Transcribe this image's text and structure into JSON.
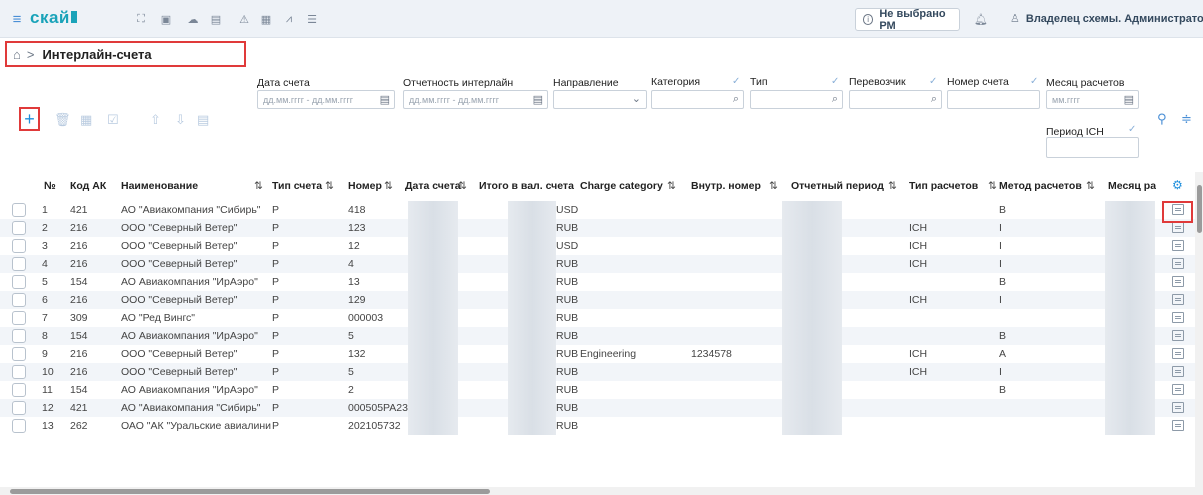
{
  "header": {
    "logo": "скай",
    "pm_button": "Не выбрано РМ",
    "pm_icon": "info-icon",
    "owner": "Владелец схемы. Администратор",
    "nav_icons": [
      "expand-icon",
      "camera-icon",
      "cloud-icon",
      "document-icon",
      "warning-icon",
      "calendar-icon",
      "chart-icon",
      "list-icon"
    ]
  },
  "breadcrumb": {
    "title": "Интерлайн-счета"
  },
  "filters": {
    "date_label": "Дата счета",
    "date_placeholder": "дд.мм.гггг - дд.мм.гггг",
    "report_label": "Отчетность интерлайн",
    "report_placeholder": "дд.мм.гггг - дд.мм.гггг",
    "direction_label": "Направление",
    "category_label": "Категория",
    "type_label": "Тип",
    "carrier_label": "Перевозчик",
    "invoice_label": "Номер счета",
    "month_label": "Месяц расчетов",
    "month_placeholder": "мм.гггг",
    "ich_label": "Период ICH"
  },
  "table": {
    "columns": [
      "№",
      "Код АК",
      "Наименование",
      "Тип счета",
      "Номер",
      "Дата счета",
      "Итого в вал. счета",
      "Charge category",
      "Внутр. номер",
      "Отчетный период",
      "Тип расчетов",
      "Метод расчетов",
      "Месяц рас"
    ],
    "rows": [
      {
        "n": "1",
        "code": "421",
        "name": "АО \"Авиакомпания \"Сибирь\"",
        "type": "P",
        "num": "418",
        "cur": "USD",
        "cat": "",
        "inner": "",
        "settle": "",
        "method": "B"
      },
      {
        "n": "2",
        "code": "216",
        "name": "ООО \"Северный Ветер\"",
        "type": "P",
        "num": "123",
        "cur": "RUB",
        "cat": "",
        "inner": "",
        "settle": "ICH",
        "method": "I"
      },
      {
        "n": "3",
        "code": "216",
        "name": "ООО \"Северный Ветер\"",
        "type": "P",
        "num": "12",
        "cur": "USD",
        "cat": "",
        "inner": "",
        "settle": "ICH",
        "method": "I"
      },
      {
        "n": "4",
        "code": "216",
        "name": "ООО \"Северный Ветер\"",
        "type": "P",
        "num": "4",
        "cur": "RUB",
        "cat": "",
        "inner": "",
        "settle": "ICH",
        "method": "I"
      },
      {
        "n": "5",
        "code": "154",
        "name": "АО Авиакомпания \"ИрАэро\"",
        "type": "P",
        "num": "13",
        "cur": "RUB",
        "cat": "",
        "inner": "",
        "settle": "",
        "method": "B"
      },
      {
        "n": "6",
        "code": "216",
        "name": "ООО \"Северный Ветер\"",
        "type": "P",
        "num": "129",
        "cur": "RUB",
        "cat": "",
        "inner": "",
        "settle": "ICH",
        "method": "I"
      },
      {
        "n": "7",
        "code": "309",
        "name": "АО \"Ред Вингс\"",
        "type": "P",
        "num": "000003",
        "cur": "RUB",
        "cat": "",
        "inner": "",
        "settle": "",
        "method": ""
      },
      {
        "n": "8",
        "code": "154",
        "name": "АО Авиакомпания \"ИрАэро\"",
        "type": "P",
        "num": "5",
        "cur": "RUB",
        "cat": "",
        "inner": "",
        "settle": "",
        "method": "B"
      },
      {
        "n": "9",
        "code": "216",
        "name": "ООО \"Северный Ветер\"",
        "type": "P",
        "num": "132",
        "cur": "RUB",
        "cat": "Engineering",
        "inner": "1234578",
        "settle": "ICH",
        "method": "A"
      },
      {
        "n": "10",
        "code": "216",
        "name": "ООО \"Северный Ветер\"",
        "type": "P",
        "num": "5",
        "cur": "RUB",
        "cat": "",
        "inner": "",
        "settle": "ICH",
        "method": "I"
      },
      {
        "n": "11",
        "code": "154",
        "name": "АО Авиакомпания \"ИрАэро\"",
        "type": "P",
        "num": "2",
        "cur": "RUB",
        "cat": "",
        "inner": "",
        "settle": "",
        "method": "B"
      },
      {
        "n": "12",
        "code": "421",
        "name": "АО \"Авиакомпания \"Сибирь\"",
        "type": "P",
        "num": "000505PA23",
        "cur": "RUB",
        "cat": "",
        "inner": "",
        "settle": "",
        "method": ""
      },
      {
        "n": "13",
        "code": "262",
        "name": "ОАО \"АК \"Уральские авиалинии",
        "type": "P",
        "num": "202105732",
        "cur": "RUB",
        "cat": "",
        "inner": "",
        "settle": "",
        "method": ""
      }
    ]
  }
}
